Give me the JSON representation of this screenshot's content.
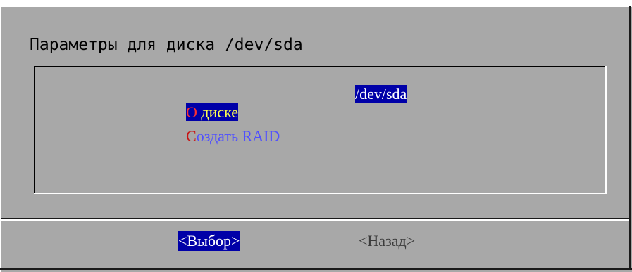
{
  "dialog": {
    "title": "Параметры для диска /dev/sda"
  },
  "menu": {
    "items": [
      {
        "hotkey": "О",
        "rest": " диске",
        "description": "/dev/sda",
        "selected": true
      },
      {
        "hotkey": "С",
        "rest": "оздать RAID",
        "description": "",
        "selected": false
      }
    ]
  },
  "buttons": {
    "select_label": "<Выбор>",
    "back_label": "<Назад>"
  },
  "colors": {
    "background": "#a8a8a8",
    "selection": "#0000a8",
    "hotkey_selected": "#ff3030",
    "text_selected": "#ffff50",
    "hotkey": "#c81414",
    "item_text": "#5050ff"
  }
}
